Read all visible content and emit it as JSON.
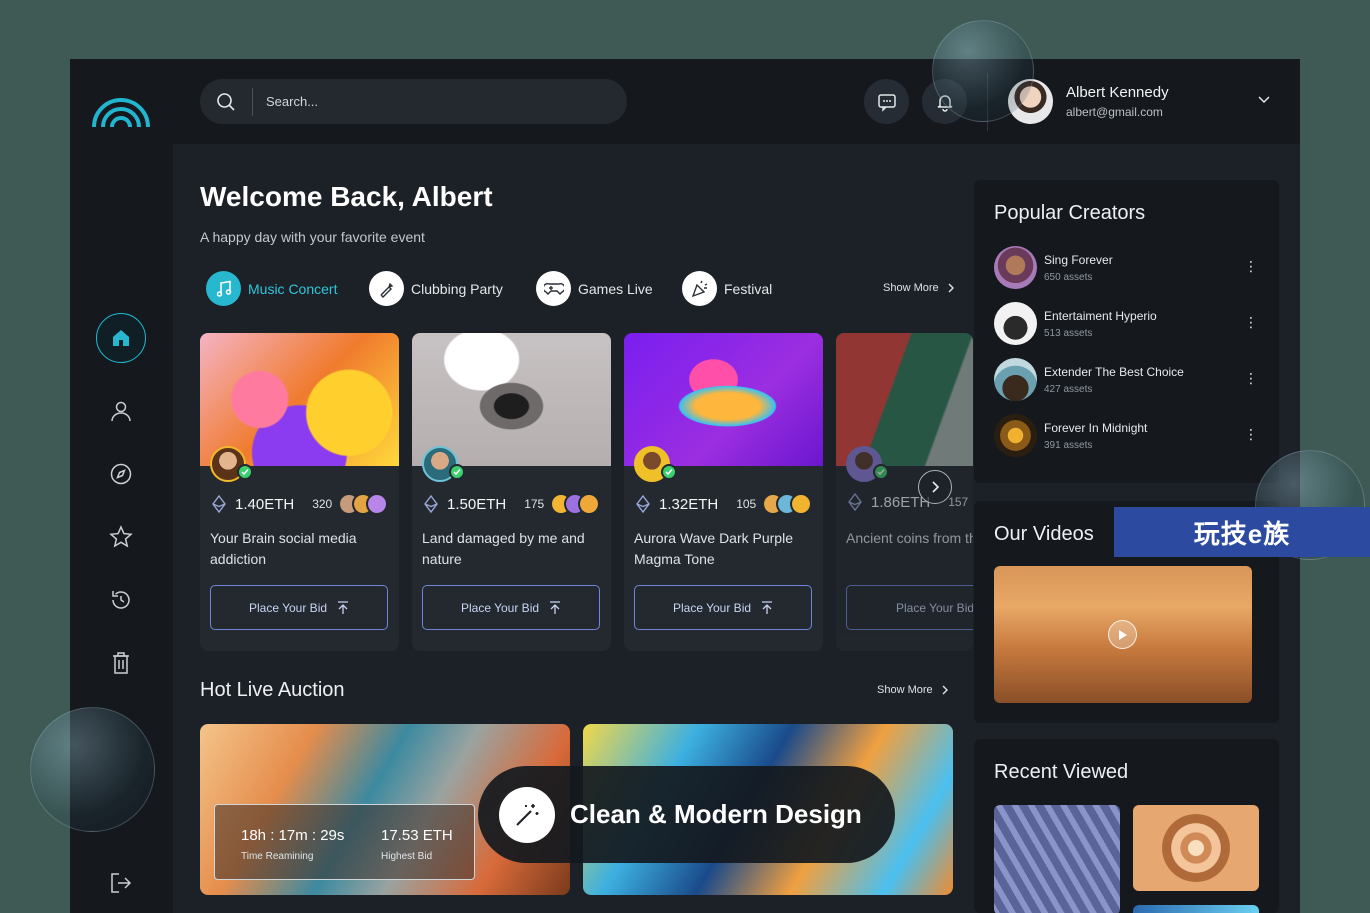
{
  "search": {
    "placeholder": "Search..."
  },
  "user": {
    "name": "Albert Kennedy",
    "email": "albert@gmail.com"
  },
  "welcome": {
    "title": "Welcome Back, Albert",
    "subtitle": "A happy day with your favorite event"
  },
  "categories": [
    {
      "label": "Music Concert",
      "icon": "music-note-icon",
      "active": true
    },
    {
      "label": "Clubbing Party",
      "icon": "champagne-bottle-icon",
      "active": false
    },
    {
      "label": "Games Live",
      "icon": "gamepad-icon",
      "active": false
    },
    {
      "label": "Festival",
      "icon": "party-popper-icon",
      "active": false
    }
  ],
  "show_more": "Show More",
  "cards": [
    {
      "price": "1.40ETH",
      "count": "320",
      "title": "Your Brain social media addiction",
      "bid_label": "Place Your Bid"
    },
    {
      "price": "1.50ETH",
      "count": "175",
      "title": "Land damaged by me and nature",
      "bid_label": "Place Your Bid"
    },
    {
      "price": "1.32ETH",
      "count": "105",
      "title": "Aurora Wave Dark Purple Magma Tone",
      "bid_label": "Place Your Bid"
    },
    {
      "price": "1.86ETH",
      "count": "157",
      "title": "Ancient coins from the past",
      "bid_label": "Place Your Bid"
    }
  ],
  "hot_auction": {
    "title": "Hot Live Auction",
    "time": "18h : 17m : 29s",
    "time_label": "Time Reamining",
    "bid": "17.53 ETH",
    "bid_label": "Highest Bid"
  },
  "banner": {
    "text": "Clean & Modern Design"
  },
  "creators": {
    "title": "Popular Creators",
    "items": [
      {
        "name": "Sing Forever",
        "assets": "650 assets"
      },
      {
        "name": "Entertaiment Hyperio",
        "assets": "513 assets"
      },
      {
        "name": "Extender The Best Choice",
        "assets": "427 assets"
      },
      {
        "name": "Forever In Midnight",
        "assets": "391 assets"
      }
    ]
  },
  "videos": {
    "title": "Our Videos"
  },
  "recent": {
    "title": "Recent Viewed"
  },
  "watermark": "玩技e族",
  "colors": {
    "accent": "#27b7cf",
    "bid_border": "#6f86d8",
    "verified": "#3ccf6e"
  }
}
